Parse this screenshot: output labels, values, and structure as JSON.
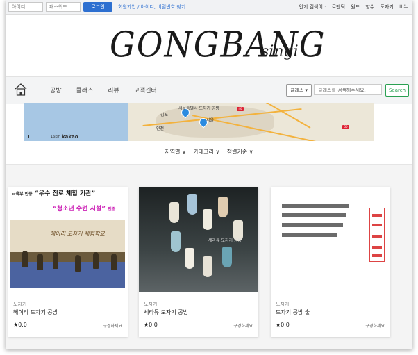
{
  "login": {
    "id_placeholder": "아이디",
    "pw_placeholder": "패스워드",
    "login_label": "로그인",
    "links": "회원가입 / 아이디, 비밀번호 찾기"
  },
  "popular": {
    "label": "인기 검색어 :",
    "terms": [
      "로맨틱",
      "원드",
      "향수",
      "도자기",
      "비누"
    ]
  },
  "logo": {
    "main": "GONGBANG",
    "sub": "singi"
  },
  "nav": {
    "items": [
      "공방",
      "클래스",
      "리뷰",
      "고객센터"
    ],
    "category_label": "클래스 ▾",
    "search_placeholder": "클래스를 검색해주세요.",
    "search_label": "Search"
  },
  "map": {
    "labels": [
      "서울특별시 도자기 공방",
      "김포",
      "서울",
      "인천"
    ],
    "scale_label": "16km",
    "brand": "kakao"
  },
  "filters": [
    "지역별 ∨",
    "카테고리 ∨",
    "정렬기준 ∨"
  ],
  "cards": [
    {
      "image_heading1_small": "교육부 인증",
      "image_heading1": "“우수 진로 체험 기관”",
      "image_heading2": "“청소년 수련 시설”",
      "image_heading2_small": "인증",
      "image_wall_text": "헤이리 도자기 체험학교",
      "category": "도자기",
      "title": "헤이리 도자기 공방",
      "rating": "★0.0",
      "subscribe": "구경하세요"
    },
    {
      "image_text": "세라듀 도자기 공방",
      "category": "도자기",
      "title": "세라듀 도자기 공방",
      "rating": "★0.0",
      "subscribe": "구경하세요"
    },
    {
      "category": "도자기",
      "title": "도자기 공방 술",
      "rating": "★0.0",
      "subscribe": "구경하세요"
    }
  ],
  "colors": {
    "accent": "#2d6fd0",
    "search_green": "#2aa052",
    "magenta": "#cc1fb5"
  }
}
